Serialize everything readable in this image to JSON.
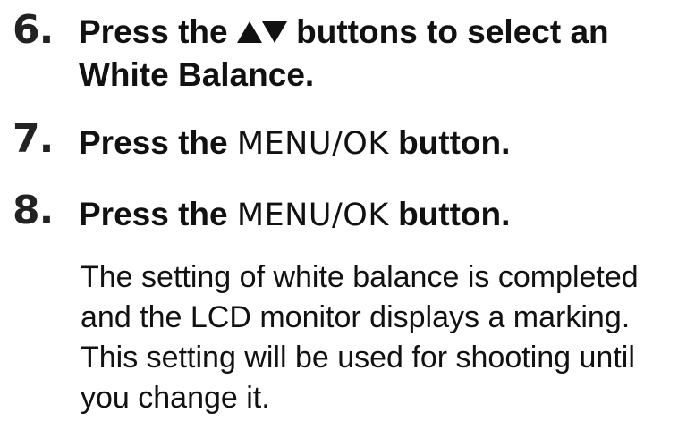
{
  "steps": [
    {
      "number": "6.",
      "text_before": "Press the",
      "icon_up": "up-triangle-icon",
      "icon_down": "down-triangle-icon",
      "text_after": "buttons to select an",
      "line2": "White Balance."
    },
    {
      "number": "7.",
      "text_before": "Press the",
      "button_name": "MENU/OK",
      "text_after": "button."
    },
    {
      "number": "8.",
      "text_before": "Press the",
      "button_name": "MENU/OK",
      "text_after": "button."
    }
  ],
  "description": {
    "lines": [
      "The setting of white balance is completed",
      "and the LCD monitor displays a marking.",
      "This setting will be used for shooting until",
      "you change it."
    ]
  }
}
